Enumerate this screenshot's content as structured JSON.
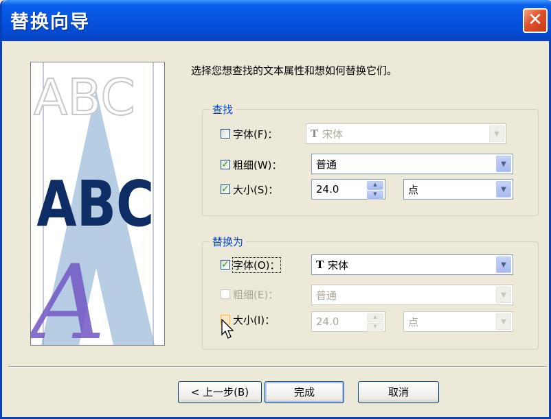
{
  "window": {
    "title": "替换向导",
    "close_symbol": "✕"
  },
  "prompt": "选择您想查找的文本属性和想如何替换它们。",
  "find": {
    "legend": "查找",
    "font": {
      "label": "字体(F)：",
      "checked": false,
      "value": "宋体",
      "tt_glyph": "T"
    },
    "weight": {
      "label": "粗细(W)：",
      "checked": true,
      "value": "普通"
    },
    "size": {
      "label": "大小(S)：",
      "checked": true,
      "value": "24.0",
      "unit": "点"
    }
  },
  "replace": {
    "legend": "替换为",
    "font": {
      "label": "字体(O)：",
      "checked": true,
      "value": "宋体",
      "tt_glyph": "T"
    },
    "weight": {
      "label": "粗细(E)：",
      "checked": false,
      "value": "普通"
    },
    "size": {
      "label": "大小(I)：",
      "checked": false,
      "value": "24.0",
      "unit": "点"
    }
  },
  "buttons": {
    "back": "< 上一步(B)",
    "finish": "完成",
    "cancel": "取消"
  },
  "preview": {
    "top_text": "ABC",
    "mid_text": "ABC",
    "script_letter": "A",
    "big_letter": "A"
  },
  "symbols": {
    "check": "✓",
    "arrow": "▼",
    "up": "▲",
    "down": "▼"
  },
  "colors": {
    "accent": "#0046d5",
    "titlebar": "#0653de",
    "check": "#21a121",
    "close": "#e0512c"
  }
}
